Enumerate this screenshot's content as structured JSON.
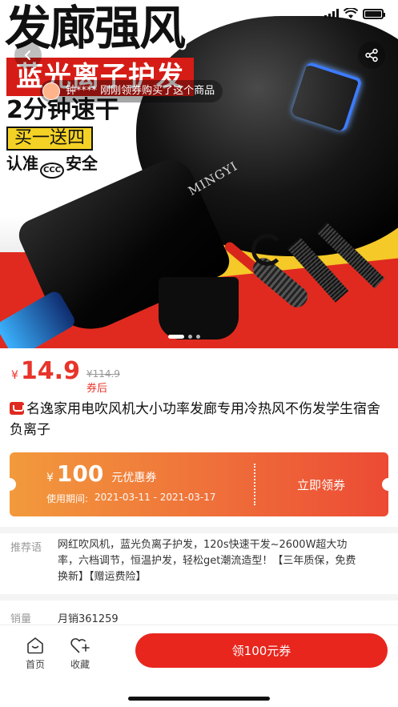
{
  "status_bar": {
    "time": ""
  },
  "banner": {
    "headline": "发廊强风",
    "feature": "蓝光离子护发",
    "speed": "2分钟速干",
    "promo": "买一送四",
    "cert_prefix": "认准",
    "cert_mark": "CCC",
    "cert_suffix": "安全",
    "brand_logo": "MINGYI"
  },
  "toast": {
    "text": "钟**** 刚刚领券购买了这个商品"
  },
  "carousel": {
    "page_count": 3,
    "active_index": 0
  },
  "price": {
    "currency": "¥",
    "current": "14.9",
    "original": "¥114.9",
    "suffix": "券后"
  },
  "product": {
    "title": "名逸家用电吹风机大小功率发廊专用冷热风不伤发学生宿舍负离子"
  },
  "coupon": {
    "currency": "¥",
    "amount": "100",
    "name": "元优惠券",
    "period_label": "使用期间:",
    "period_value": "2021-03-11 - 2021-03-17",
    "cta": "立即领券"
  },
  "recommend": {
    "label": "推荐语",
    "text": "网红吹风机，蓝光负离子护发，120s快速干发~2600W超大功率，六档调节，恒温护发，轻松get潮流造型！【三年质保，免费换新】【赠运费险】"
  },
  "sales": {
    "label": "销量",
    "value": "月销361259"
  },
  "bottom_nav": {
    "home_label": "首页",
    "fav_label": "收藏",
    "cta_label": "领100元券"
  },
  "colors": {
    "accent": "#e8261d",
    "price": "#e8342a",
    "coupon_start": "#f29a3c",
    "coupon_end": "#ec4a34"
  },
  "icons": [
    "back-icon",
    "share-icon",
    "home-icon",
    "favorite-add-icon"
  ]
}
